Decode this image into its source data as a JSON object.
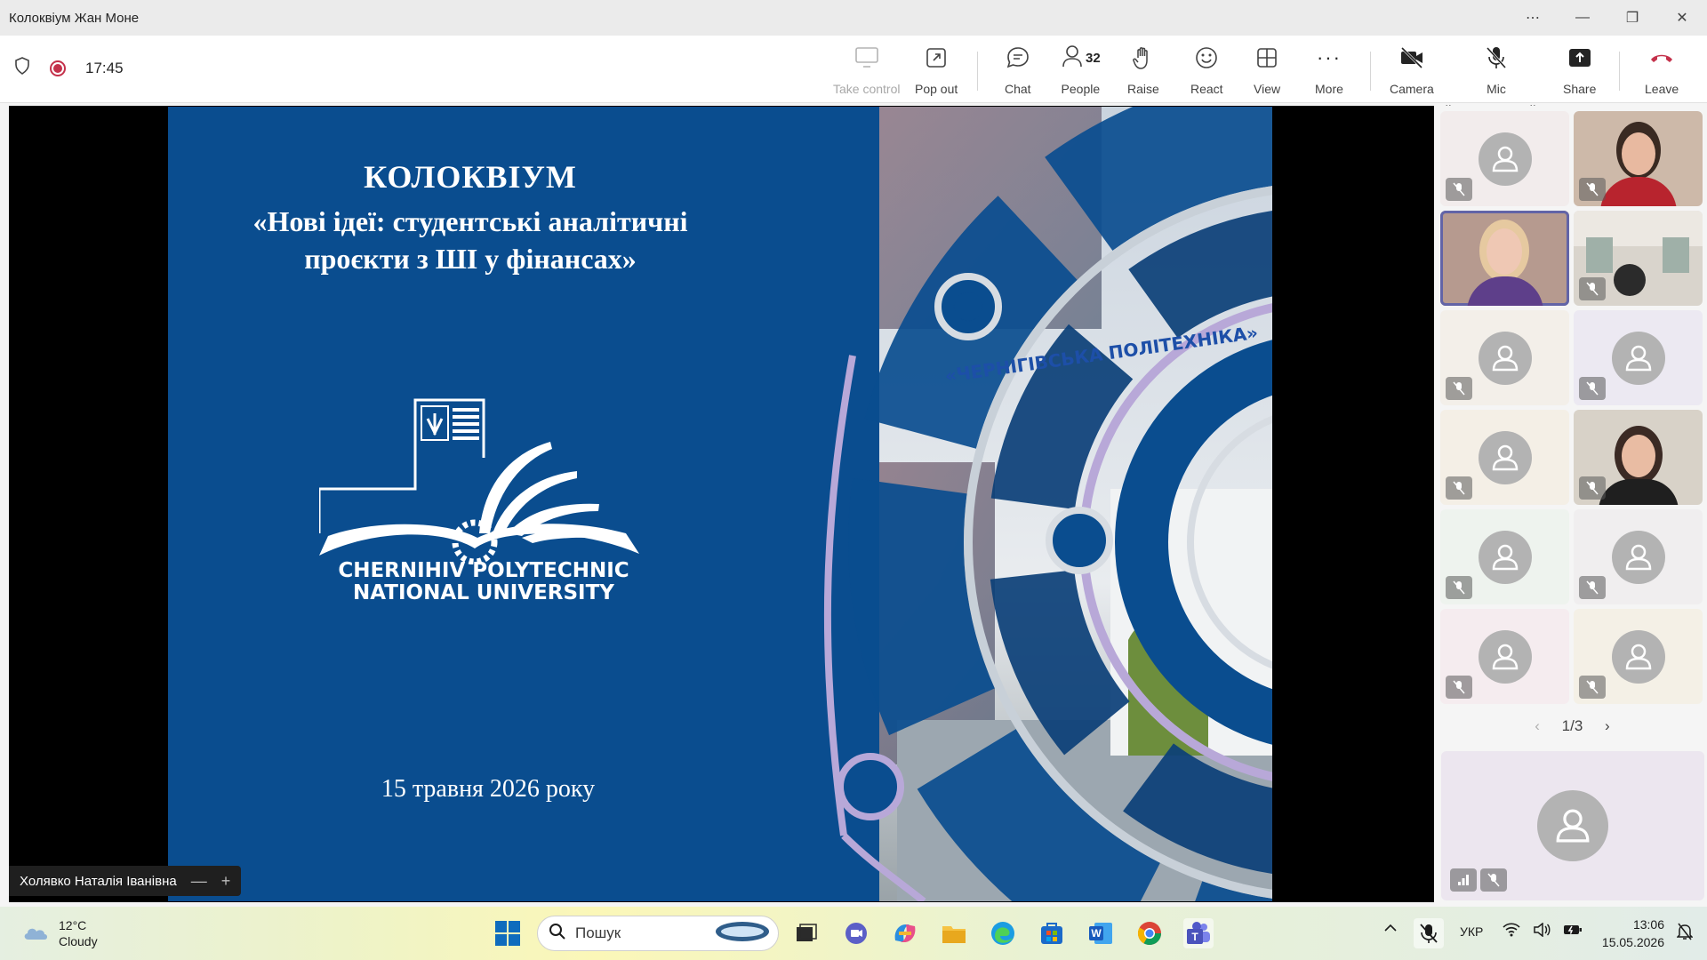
{
  "window": {
    "title": "Колоквіум Жан Моне"
  },
  "meeting": {
    "timer": "17:45"
  },
  "toolbar": {
    "take_control": "Take control",
    "pop_out": "Pop out",
    "chat": "Chat",
    "people": "People",
    "people_count": "32",
    "raise": "Raise",
    "react": "React",
    "view": "View",
    "more": "More",
    "camera": "Camera",
    "mic": "Mic",
    "share": "Share",
    "leave": "Leave"
  },
  "slide": {
    "title_line1": "КОЛОКВІУМ",
    "title_line2": "«Нові ідеї: студентські аналітичні",
    "title_line3": "проєкти з ШІ у фінансах»",
    "university_line1": "CHERNIHIV POLYTECHNIC",
    "university_line2": "NATIONAL UNIVERSITY",
    "building_sign": "«ЧЕРНІГІВСЬКА ПОЛІТЕХНІКА»",
    "date": "15 травня 2026 року"
  },
  "speaker": {
    "name": "Холявко Наталія Іванівна"
  },
  "participants_pager": "1/3",
  "taskbar": {
    "weather_temp": "12°C",
    "weather_desc": "Cloudy",
    "search_placeholder": "Пошук",
    "language": "УКР",
    "time": "13:06",
    "date": "15.05.2026"
  },
  "colors": {
    "slide_bg": "#0a4d8f",
    "accent": "#6264a7",
    "leave_red": "#c4314b"
  }
}
